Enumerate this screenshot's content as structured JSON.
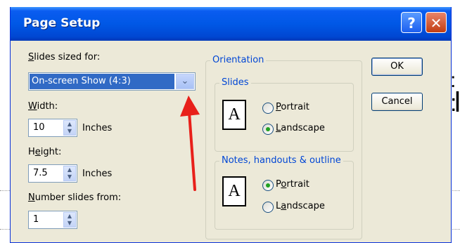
{
  "dialog": {
    "title": "Page Setup",
    "help_glyph": "?",
    "close_glyph": "✕"
  },
  "slides_sized_for": {
    "label_accel": "S",
    "label_rest": "lides sized for:",
    "value": "On-screen Show (4:3)"
  },
  "width": {
    "label_accel": "W",
    "label_rest": "idth:",
    "value": "10",
    "unit": "Inches"
  },
  "height": {
    "label_pre": "H",
    "label_accel": "e",
    "label_rest": "ight:",
    "value": "7.5",
    "unit": "Inches"
  },
  "number_slides_from": {
    "label_accel": "N",
    "label_rest": "umber slides from:",
    "value": "1"
  },
  "orientation": {
    "title": "Orientation",
    "slides": {
      "title": "Slides",
      "portrait_accel": "P",
      "portrait_rest": "ortrait",
      "landscape_accel": "L",
      "landscape_rest": "andscape",
      "selected": "landscape"
    },
    "notes": {
      "title": "Notes, handouts & outline",
      "portrait_pre": "P",
      "portrait_accel": "o",
      "portrait_rest": "rtrait",
      "landscape_pre": "L",
      "landscape_accel": "a",
      "landscape_rest": "ndscape",
      "selected": "portrait"
    },
    "page_glyph": "A"
  },
  "buttons": {
    "ok": "OK",
    "cancel": "Cancel"
  },
  "colors": {
    "titlebar": "#0058e6",
    "accent_label": "#0046d5",
    "annotation_arrow": "#e8201a"
  }
}
